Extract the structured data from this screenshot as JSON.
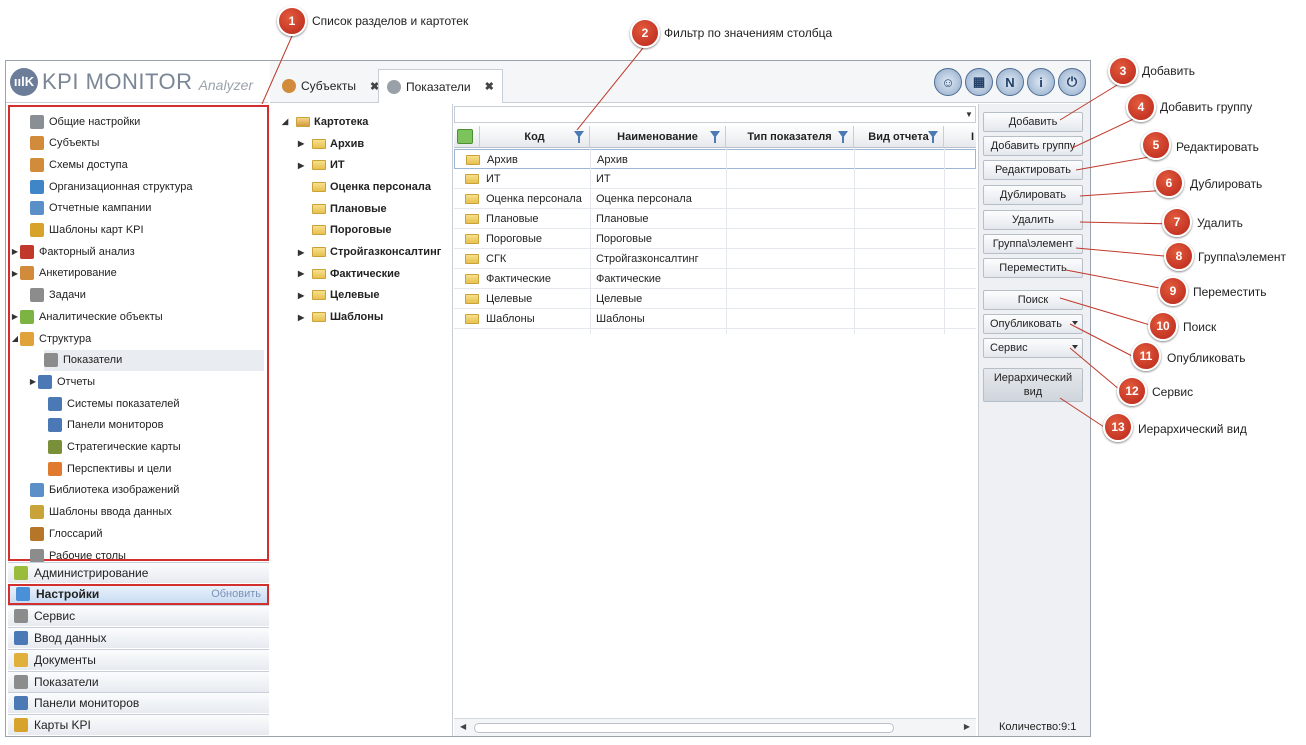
{
  "app": {
    "brand": "KPI MONITOR",
    "brand_sub": "Analyzer",
    "logo_mark": "ıılK"
  },
  "nav_tree": [
    {
      "label": "Общие настройки",
      "icon": "gear-icon",
      "color": "#8a8f96"
    },
    {
      "label": "Субъекты",
      "icon": "users-icon",
      "color": "#d28b3a"
    },
    {
      "label": "Схемы доступа",
      "icon": "users-icon",
      "color": "#d28b3a"
    },
    {
      "label": "Организационная структура",
      "icon": "org-chart-icon",
      "color": "#3f86c9"
    },
    {
      "label": "Отчетные кампании",
      "icon": "calendar-icon",
      "color": "#5b8fc7"
    },
    {
      "label": "Шаблоны карт KPI",
      "icon": "grid-icon",
      "color": "#d8a32a"
    },
    {
      "label": "Факторный анализ",
      "icon": "chart-icon",
      "color": "#c0392b"
    },
    {
      "label": "Анкетирование",
      "icon": "users-icon",
      "color": "#d28b3a"
    },
    {
      "label": "Задачи",
      "icon": "tasks-icon",
      "color": "#8c8c8c"
    },
    {
      "label": "Аналитические объекты",
      "icon": "cubes-icon",
      "color": "#7cb342"
    },
    {
      "label": "Структура",
      "icon": "cubes-icon",
      "color": "#e0a23a"
    },
    {
      "label": "Показатели",
      "icon": "gauge-icon",
      "color": "#8c8c8c"
    },
    {
      "label": "Отчеты",
      "icon": "report-icon",
      "color": "#4a79b5"
    },
    {
      "label": "Системы показателей",
      "icon": "hierarchy-icon",
      "color": "#4a79b5"
    },
    {
      "label": "Панели мониторов",
      "icon": "dashboard-icon",
      "color": "#4a79b5"
    },
    {
      "label": "Стратегические карты",
      "icon": "map-icon",
      "color": "#7a8f3a"
    },
    {
      "label": "Перспективы и цели",
      "icon": "target-icon",
      "color": "#e07a2e"
    },
    {
      "label": "Библиотека изображений",
      "icon": "image-icon",
      "color": "#5b8fc7"
    },
    {
      "label": "Шаблоны ввода данных",
      "icon": "form-icon",
      "color": "#c9a33a"
    },
    {
      "label": "Глоссарий",
      "icon": "book-icon",
      "color": "#b5762a"
    },
    {
      "label": "Рабочие столы",
      "icon": "desktop-icon",
      "color": "#8c8c8c"
    }
  ],
  "sections": [
    {
      "label": "Администрирование",
      "icon": "admin-icon",
      "color": "#9bbb3a"
    },
    {
      "label": "Настройки",
      "icon": "settings-icon",
      "color": "#4a90d9",
      "refresh": "Обновить"
    },
    {
      "label": "Сервис",
      "icon": "tools-icon",
      "color": "#8c8c8c"
    },
    {
      "label": "Ввод данных",
      "icon": "data-entry-icon",
      "color": "#4a79b5"
    },
    {
      "label": "Документы",
      "icon": "document-icon",
      "color": "#e0b03a"
    },
    {
      "label": "Показатели",
      "icon": "gauge-icon",
      "color": "#8c8c8c"
    },
    {
      "label": "Панели мониторов",
      "icon": "dashboard-icon",
      "color": "#4a79b5"
    },
    {
      "label": "Карты KPI",
      "icon": "grid-icon",
      "color": "#d8a32a"
    }
  ],
  "tabs": [
    {
      "label": "Субъекты",
      "close": "✖"
    },
    {
      "label": "Показатели",
      "close": "✖"
    }
  ],
  "top_icons": [
    "user-avatar-icon",
    "calculator-icon",
    "news-icon",
    "info-icon",
    "power-icon"
  ],
  "catalog": {
    "root": "Картотека",
    "items": [
      {
        "label": "Архив",
        "expandable": true
      },
      {
        "label": "ИТ",
        "expandable": true
      },
      {
        "label": "Оценка персонала",
        "expandable": false
      },
      {
        "label": "Плановые",
        "expandable": false
      },
      {
        "label": "Пороговые",
        "expandable": false
      },
      {
        "label": "Стройгазконсалтинг",
        "expandable": true
      },
      {
        "label": "Фактические",
        "expandable": true
      },
      {
        "label": "Целевые",
        "expandable": true
      },
      {
        "label": "Шаблоны",
        "expandable": true
      }
    ]
  },
  "grid": {
    "columns": [
      "Код",
      "Наименование",
      "Тип показателя",
      "Вид отчета",
      "I"
    ],
    "rows": [
      [
        "Архив",
        "Архив"
      ],
      [
        "ИТ",
        "ИТ"
      ],
      [
        "Оценка персонала",
        "Оценка персонала"
      ],
      [
        "Плановые",
        "Плановые"
      ],
      [
        "Пороговые",
        "Пороговые"
      ],
      [
        "СГК",
        "Стройгазконсалтинг"
      ],
      [
        "Фактические",
        "Фактические"
      ],
      [
        "Целевые",
        "Целевые"
      ],
      [
        "Шаблоны",
        "Шаблоны"
      ]
    ]
  },
  "actions": [
    "Добавить",
    "Добавить группу",
    "Редактировать",
    "Дублировать",
    "Удалить",
    "Группа\\элемент",
    "Переместить",
    "Поиск",
    "Опубликовать",
    "Сервис",
    "Иерархический вид"
  ],
  "count_label": "Количество:9:1",
  "callouts": [
    {
      "n": "1",
      "text": "Список разделов и картотек"
    },
    {
      "n": "2",
      "text": "Фильтр по значениям столбца"
    },
    {
      "n": "3",
      "text": "Добавить"
    },
    {
      "n": "4",
      "text": "Добавить группу"
    },
    {
      "n": "5",
      "text": "Редактировать"
    },
    {
      "n": "6",
      "text": "Дублировать"
    },
    {
      "n": "7",
      "text": "Удалить"
    },
    {
      "n": "8",
      "text": "Группа\\элемент"
    },
    {
      "n": "9",
      "text": "Переместить"
    },
    {
      "n": "10",
      "text": "Поиск"
    },
    {
      "n": "11",
      "text": "Опубликовать"
    },
    {
      "n": "12",
      "text": "Сервис"
    },
    {
      "n": "13",
      "text": "Иерархический вид"
    }
  ]
}
